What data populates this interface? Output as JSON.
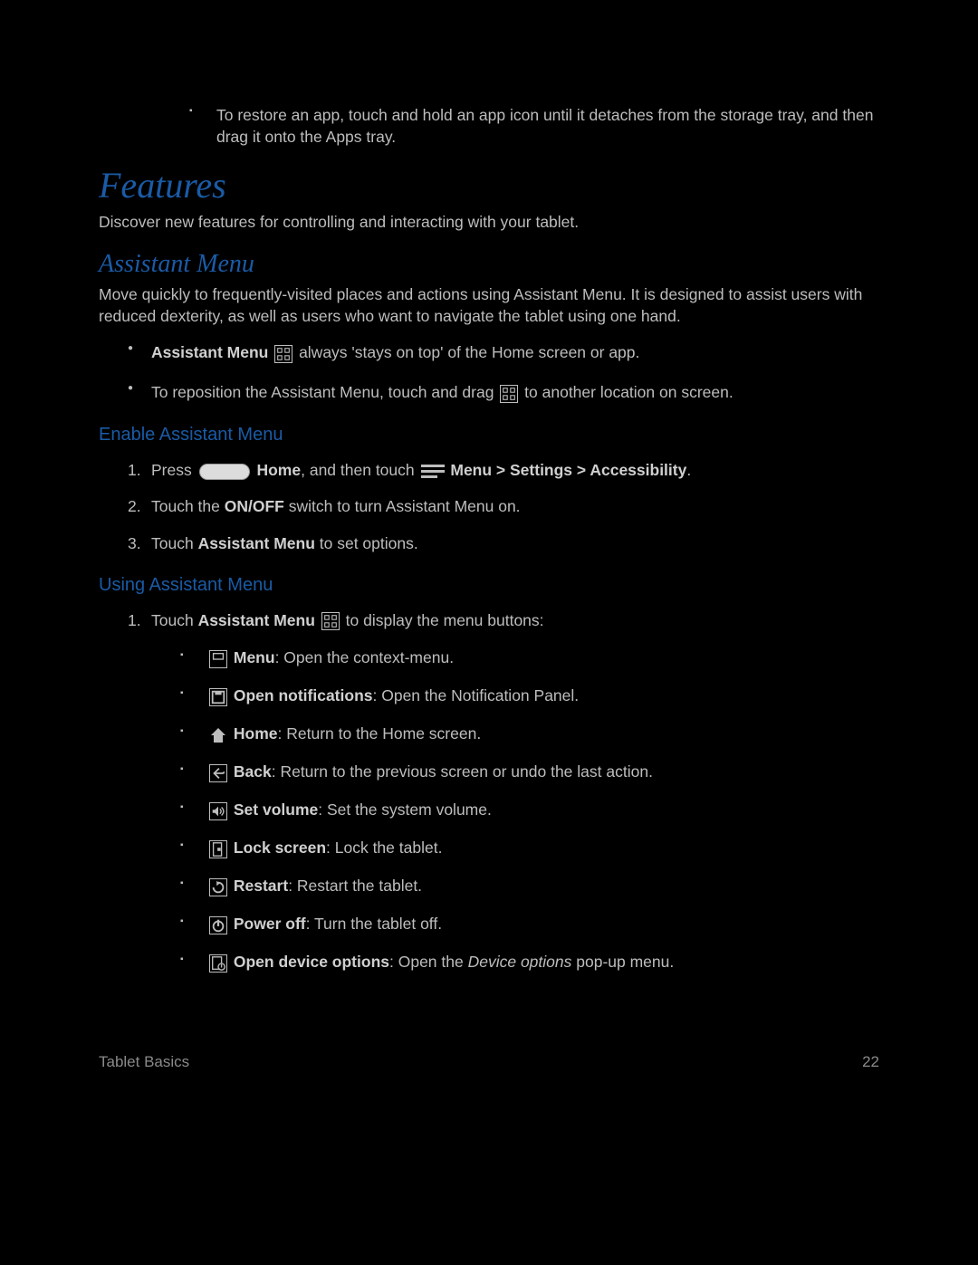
{
  "intro_bullet": "To restore an app, touch and hold an app icon until it detaches from the storage tray, and then drag it onto the Apps tray.",
  "h1": "Features",
  "h1_sub": "Discover new features for controlling and interacting with your tablet.",
  "h2": "Assistant Menu",
  "h2_desc": "Move quickly to frequently-visited places and actions using Assistant Menu. It is designed to assist users with reduced dexterity, as well as users who want to navigate the tablet using one hand.",
  "bullet1_bold": "Assistant Menu",
  "bullet1_rest": " always 'stays on top' of the Home screen or app.",
  "bullet2_a": "To reposition the Assistant Menu, touch and drag ",
  "bullet2_b": " to another location on screen.",
  "h3a": "Enable Assistant Menu",
  "step1_a": "Press ",
  "step1_home": "Home",
  "step1_b": ", and then touch ",
  "step1_path": "Menu > Settings > Accessibility",
  "step1_end": ".",
  "step2_a": "Touch the ",
  "step2_b": "ON/OFF",
  "step2_c": " switch to turn Assistant Menu on.",
  "step3_a": "Touch ",
  "step3_b": "Assistant Menu",
  "step3_c": " to set options.",
  "h3b": "Using Assistant Menu",
  "use1_a": "Touch ",
  "use1_b": "Assistant Menu",
  "use1_c": " to display the menu buttons:",
  "menu_items": [
    {
      "label": "Menu",
      "desc": ": Open the context-menu."
    },
    {
      "label": "Open notifications",
      "desc": ": Open the Notification Panel."
    },
    {
      "label": "Home",
      "desc": ": Return to the Home screen."
    },
    {
      "label": "Back",
      "desc": ": Return to the previous screen or undo the last action."
    },
    {
      "label": "Set volume",
      "desc": ": Set the system volume."
    },
    {
      "label": "Lock screen",
      "desc": ": Lock the tablet."
    },
    {
      "label": "Restart",
      "desc": ": Restart the tablet."
    },
    {
      "label": "Power off",
      "desc": ": Turn the tablet off."
    },
    {
      "label": "Open device options",
      "desc_a": ": Open the ",
      "desc_em": "Device options",
      "desc_b": " pop-up menu."
    }
  ],
  "footer_left": "Tablet Basics",
  "footer_right": "22"
}
